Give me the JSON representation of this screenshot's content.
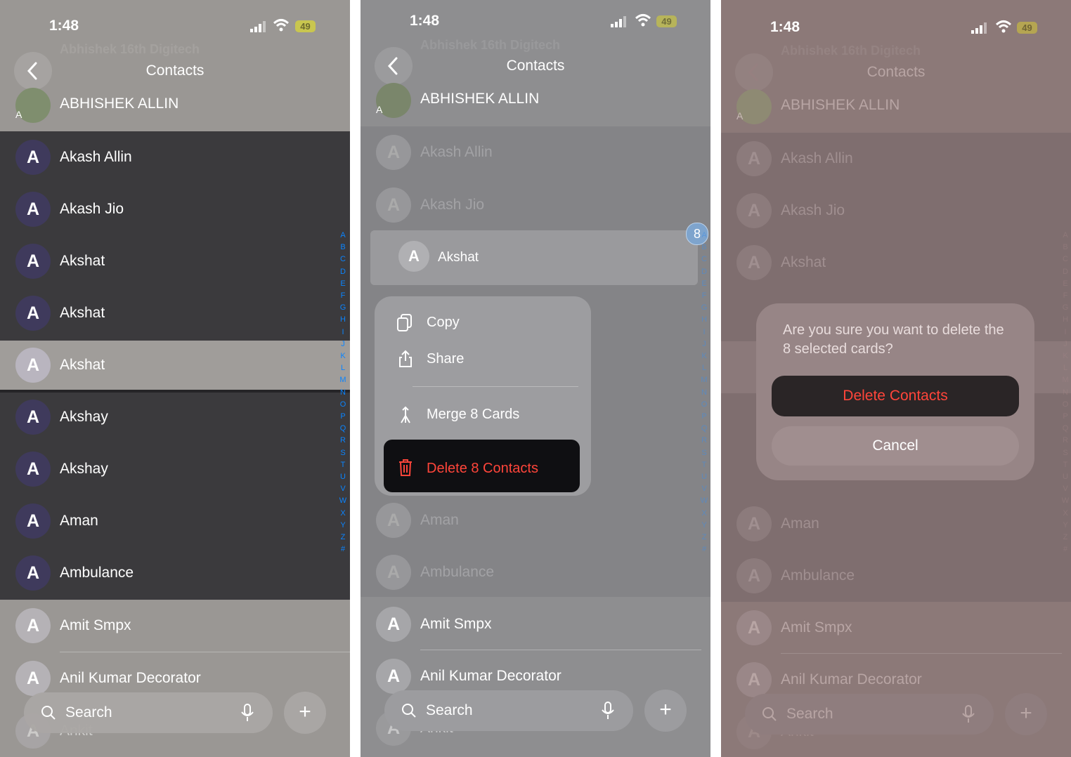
{
  "status": {
    "time": "1:48",
    "battery": "49"
  },
  "nav": {
    "title": "Contacts"
  },
  "header_contact": {
    "name": "ABHISHEK ALLIN",
    "initial": "A"
  },
  "blurred_top": "Abhishek 16th Digitech",
  "contacts": [
    {
      "name": "Akash Allin",
      "initial": "A"
    },
    {
      "name": "Akash Jio",
      "initial": "A"
    },
    {
      "name": "Akshat",
      "initial": "A"
    },
    {
      "name": "Akshat",
      "initial": "A"
    },
    {
      "name": "Akshat",
      "initial": "A"
    },
    {
      "name": "Akshay",
      "initial": "A"
    },
    {
      "name": "Akshay",
      "initial": "A"
    },
    {
      "name": "Aman",
      "initial": "A"
    },
    {
      "name": "Ambulance",
      "initial": "A"
    },
    {
      "name": "Amit Smpx",
      "initial": "A"
    },
    {
      "name": "Anil Kumar Decorator",
      "initial": "A"
    },
    {
      "name": "Ankit",
      "initial": "A"
    }
  ],
  "index_letters": [
    "A",
    "B",
    "C",
    "D",
    "E",
    "F",
    "G",
    "H",
    "I",
    "J",
    "K",
    "L",
    "M",
    "N",
    "O",
    "P",
    "Q",
    "R",
    "S",
    "T",
    "U",
    "V",
    "W",
    "X",
    "Y",
    "Z",
    "#"
  ],
  "search": {
    "placeholder": "Search"
  },
  "selected_count_badge": "8",
  "context_menu": {
    "copy": "Copy",
    "share": "Share",
    "merge": "Merge 8 Cards",
    "delete": "Delete 8 Contacts"
  },
  "dialog": {
    "message": "Are you sure you want to delete the 8 selected cards?",
    "delete_button": "Delete Contacts",
    "cancel_button": "Cancel"
  },
  "colors": {
    "accent_blue": "#0a84ff",
    "destructive_red": "#ff453a",
    "battery_yellow": "#c9c64f"
  }
}
